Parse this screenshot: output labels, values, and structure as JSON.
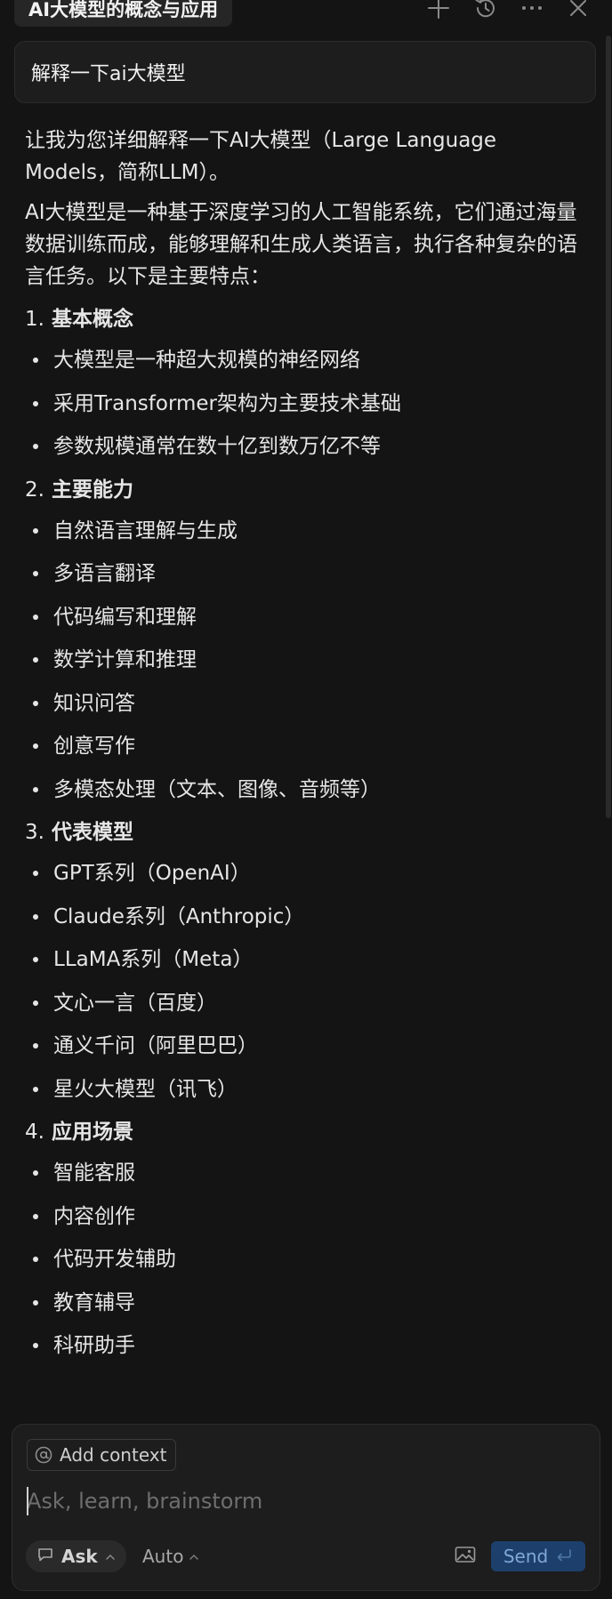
{
  "header": {
    "title": "AI大模型的概念与应用",
    "buttons": [
      "new-chat",
      "history",
      "more",
      "close"
    ]
  },
  "query": {
    "text": "解释一下ai大模型"
  },
  "answer": {
    "intro": "让我为您详细解释一下AI大模型（Large Language Models，简称LLM）。",
    "summary": "AI大模型是一种基于深度学习的人工智能系统，它们通过海量数据训练而成，能够理解和生成人类语言，执行各种复杂的语言任务。以下是主要特点：",
    "sections": [
      {
        "num": "1.",
        "title": "基本概念",
        "items": [
          "大模型是一种超大规模的神经网络",
          "采用Transformer架构为主要技术基础",
          "参数规模通常在数十亿到数万亿不等"
        ]
      },
      {
        "num": "2.",
        "title": "主要能力",
        "items": [
          "自然语言理解与生成",
          "多语言翻译",
          "代码编写和理解",
          "数学计算和推理",
          "知识问答",
          "创意写作",
          "多模态处理（文本、图像、音频等）"
        ]
      },
      {
        "num": "3.",
        "title": "代表模型",
        "items": [
          "GPT系列（OpenAI）",
          "Claude系列（Anthropic）",
          "LLaMA系列（Meta）",
          "文心一言（百度）",
          "通义千问（阿里巴巴）",
          "星火大模型（讯飞）"
        ]
      },
      {
        "num": "4.",
        "title": "应用场景",
        "items": [
          "智能客服",
          "内容创作",
          "代码开发辅助",
          "教育辅导",
          "科研助手"
        ]
      }
    ]
  },
  "composer": {
    "add_context_label": "Add context",
    "placeholder": "Ask, learn, brainstorm",
    "value": "",
    "mode_label": "Ask",
    "model_label": "Auto",
    "send_label": "Send"
  },
  "colors": {
    "background": "#141414",
    "panel": "#1d1d1d",
    "send_bg": "#1d3f6b",
    "send_text": "#7fa8d8"
  }
}
